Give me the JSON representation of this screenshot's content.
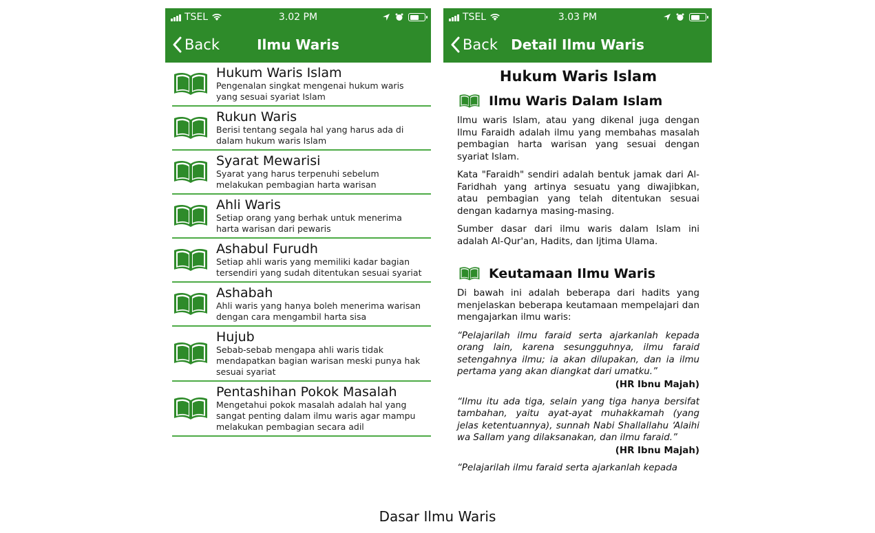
{
  "left_screen": {
    "status": {
      "carrier": "TSEL",
      "time": "3.02 PM"
    },
    "nav": {
      "back_label": "Back",
      "title": "Ilmu Waris"
    },
    "items": [
      {
        "title": "Hukum Waris Islam",
        "desc": "Pengenalan singkat mengenai hukum waris yang sesuai syariat Islam"
      },
      {
        "title": "Rukun Waris",
        "desc": "Berisi tentang segala hal yang harus ada di dalam hukum waris Islam"
      },
      {
        "title": "Syarat Mewarisi",
        "desc": "Syarat yang harus terpenuhi sebelum melakukan pembagian harta warisan"
      },
      {
        "title": "Ahli Waris",
        "desc": "Setiap orang yang berhak untuk menerima harta warisan dari pewaris"
      },
      {
        "title": "Ashabul Furudh",
        "desc": "Setiap ahli waris yang memiliki kadar bagian tersendiri yang sudah ditentukan sesuai syariat"
      },
      {
        "title": "Ashabah",
        "desc": "Ahli waris yang hanya boleh menerima warisan dengan cara mengambil harta sisa"
      },
      {
        "title": "Hujub",
        "desc": "Sebab-sebab mengapa ahli waris tidak mendapatkan bagian warisan meski punya hak sesuai syariat"
      },
      {
        "title": "Pentashihan Pokok Masalah",
        "desc": "Mengetahui pokok masalah adalah hal yang sangat penting dalam ilmu waris agar mampu melakukan pembagian secara adil"
      }
    ]
  },
  "right_screen": {
    "status": {
      "carrier": "TSEL",
      "time": "3.03 PM"
    },
    "nav": {
      "back_label": "Back",
      "title": "Detail Ilmu Waris"
    },
    "heading": "Hukum Waris Islam",
    "section1": {
      "title": "Ilmu Waris Dalam Islam",
      "p1": "Ilmu waris Islam, atau yang dikenal juga dengan Ilmu Faraidh adalah ilmu yang membahas masalah pembagian harta warisan yang sesuai dengan syariat Islam.",
      "p2": "Kata \"Faraidh\" sendiri adalah bentuk jamak dari Al-Faridhah yang artinya sesuatu yang diwajibkan, atau pembagian yang telah ditentukan sesuai dengan kadarnya masing-masing.",
      "p3": "Sumber dasar dari ilmu waris dalam Islam ini adalah Al-Qur'an, Hadits, dan Ijtima Ulama."
    },
    "section2": {
      "title": "Keutamaan Ilmu Waris",
      "intro": "Di bawah ini adalah beberapa dari hadits yang menjelaskan beberapa keutamaan mempelajari dan mengajarkan ilmu waris:",
      "q1": "“Pelajarilah ilmu faraid serta ajarkanlah kepada orang lain, karena sesungguhnya, ilmu faraid setengahnya ilmu; ia akan dilupakan, dan ia ilmu pertama yang akan diangkat dari umatku.”",
      "q1_src": "(HR Ibnu Majah)",
      "q2": "“Ilmu itu ada tiga, selain yang tiga hanya bersifat tambahan, yaitu ayat-ayat muhakkamah (yang jelas ketentuannya), sunnah Nabi Shallallahu ‘Alaihi wa Sallam yang dilaksanakan, dan ilmu faraid.”",
      "q2_src": "(HR Ibnu Majah)",
      "q3": "“Pelajarilah ilmu faraid serta ajarkanlah kepada"
    }
  },
  "caption": "Dasar Ilmu Waris",
  "colors": {
    "brand_green": "#2e8b2a",
    "divider_green": "#4caa45"
  },
  "icons": [
    "signal-icon",
    "wifi-icon",
    "location-icon",
    "alarm-icon",
    "battery-icon",
    "back-chevron-icon",
    "book-icon"
  ]
}
